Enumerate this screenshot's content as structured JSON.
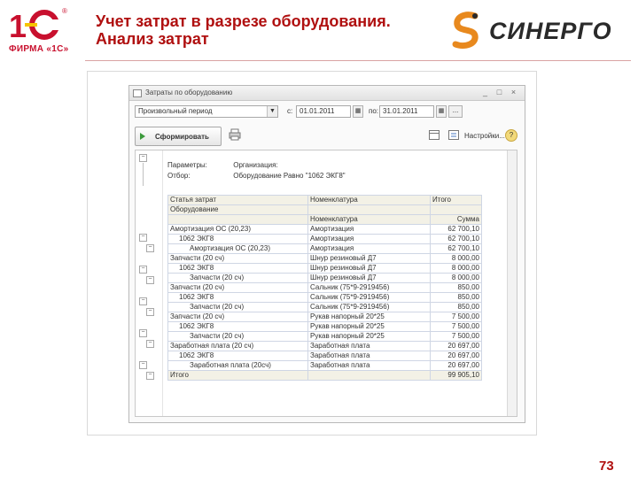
{
  "slide": {
    "title_line1": "Учет затрат в разрезе оборудования.",
    "title_line2": "Анализ затрат",
    "logo_1c_text": "ФИРМА «1С»",
    "logo_1c_reg": "®",
    "sinergo_text": "СИНЕРГО",
    "page_number": "73",
    "colors": {
      "title": "#b01010",
      "logo_red": "#c8102e",
      "logo_yellow": "#f6c400",
      "sinergo_orange": "#e8891e"
    }
  },
  "window": {
    "title": "Затраты по оборудованию",
    "controls": [
      "□",
      "×"
    ],
    "period_mode": "Произвольный период",
    "from_label": "с:",
    "from_value": "01.01.2011",
    "to_label": "по:",
    "to_value": "31.01.2011",
    "dots": "...",
    "generate_button": "Сформировать",
    "settings_label": "Настройки...",
    "help": "?"
  },
  "report": {
    "params_label": "Параметры:",
    "params_value": "Организация:",
    "filter_label": "Отбор:",
    "filter_value": "Оборудование Равно \"1062 ЭКГ8\"",
    "header": [
      [
        "Статья затрат",
        "Номенклатура",
        "Итого"
      ],
      [
        "Оборудование",
        "",
        ""
      ],
      [
        "",
        "Номенклатура",
        "Сумма"
      ]
    ],
    "rows": [
      [
        "Амортизация ОС (20,23)",
        "Амортизация",
        "62 700,10"
      ],
      [
        "1062 ЭКГ8",
        "Амортизация",
        "62 700,10"
      ],
      [
        "Амортизация ОС (20,23)",
        "Амортизация",
        "62 700,10"
      ],
      [
        "Запчасти (20 сч)",
        "Шнур резиновый Д7",
        "8 000,00"
      ],
      [
        "1062 ЭКГ8",
        "Шнур резиновый Д7",
        "8 000,00"
      ],
      [
        "Запчасти (20 сч)",
        "Шнур резиновый Д7",
        "8 000,00"
      ],
      [
        "Запчасти (20 сч)",
        "Сальник (75*9-2919456)",
        "850,00"
      ],
      [
        "1062 ЭКГ8",
        "Сальник (75*9-2919456)",
        "850,00"
      ],
      [
        "Запчасти (20 сч)",
        "Сальник (75*9-2919456)",
        "850,00"
      ],
      [
        "Запчасти (20 сч)",
        "Рукав напорный 20*25",
        "7 500,00"
      ],
      [
        "1062 ЭКГ8",
        "Рукав напорный 20*25",
        "7 500,00"
      ],
      [
        "Запчасти (20 сч)",
        "Рукав напорный 20*25",
        "7 500,00"
      ],
      [
        "Заработная плата (20 сч)",
        "Заработная плата",
        "20 697,00"
      ],
      [
        "1062 ЭКГ8",
        "Заработная плата",
        "20 697,00"
      ],
      [
        "Заработная плата (20сч)",
        "Заработная плата",
        "20 697,00"
      ]
    ],
    "total_label": "Итого",
    "total_value": "99 905,10"
  }
}
